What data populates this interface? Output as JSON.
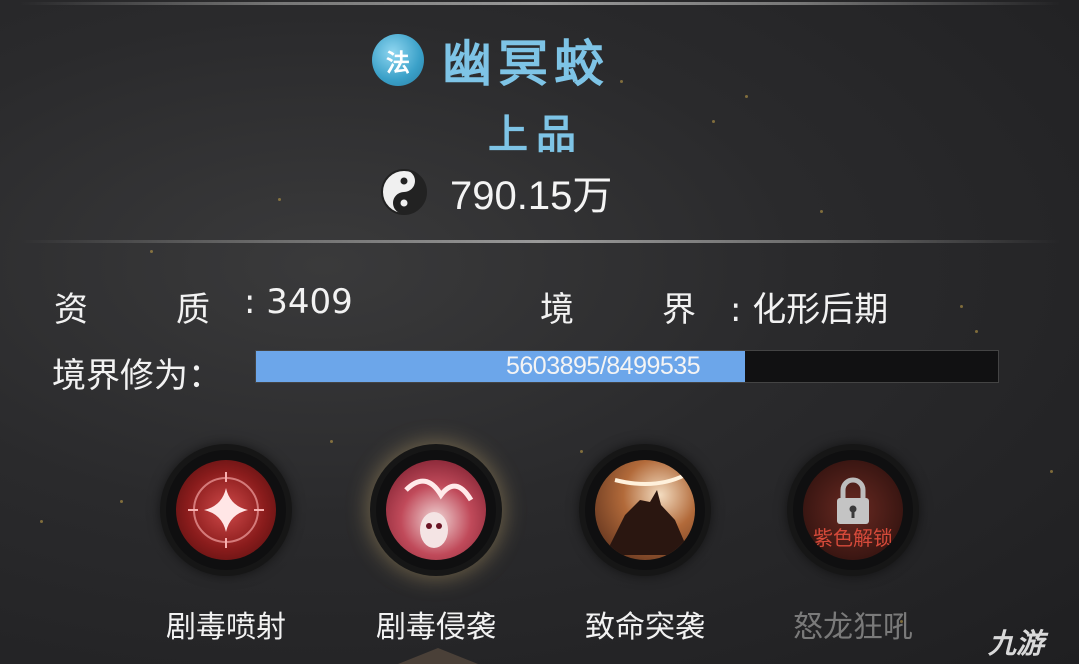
{
  "pet": {
    "type_badge": "法",
    "name": "幽冥蛟",
    "grade": "上品",
    "power": "790.15万"
  },
  "stats": {
    "aptitude_label_1": "资",
    "aptitude_label_2": "质",
    "aptitude_value": ": 3409",
    "realm_label_1": "境",
    "realm_label_2": "界",
    "realm_value": ": 化形后期"
  },
  "cultivation": {
    "label": "境界修为：",
    "progress_text": "5603895/8499535",
    "current": 5603895,
    "max": 8499535
  },
  "skills": [
    {
      "name": "剧毒喷射",
      "icon": "red-star-burst-icon",
      "locked": false
    },
    {
      "name": "剧毒侵袭",
      "icon": "poison-ghost-icon",
      "locked": false
    },
    {
      "name": "致命突袭",
      "icon": "wolf-strike-icon",
      "locked": false
    },
    {
      "name": "怒龙狂吼",
      "icon": "lock-icon",
      "locked": true,
      "lock_text": "紫色解锁"
    }
  ],
  "watermark": "九游",
  "colors": {
    "accent_blue": "#7ec4e6",
    "bar_fill": "#6ca6ea",
    "lock_red": "#d64a3a"
  }
}
